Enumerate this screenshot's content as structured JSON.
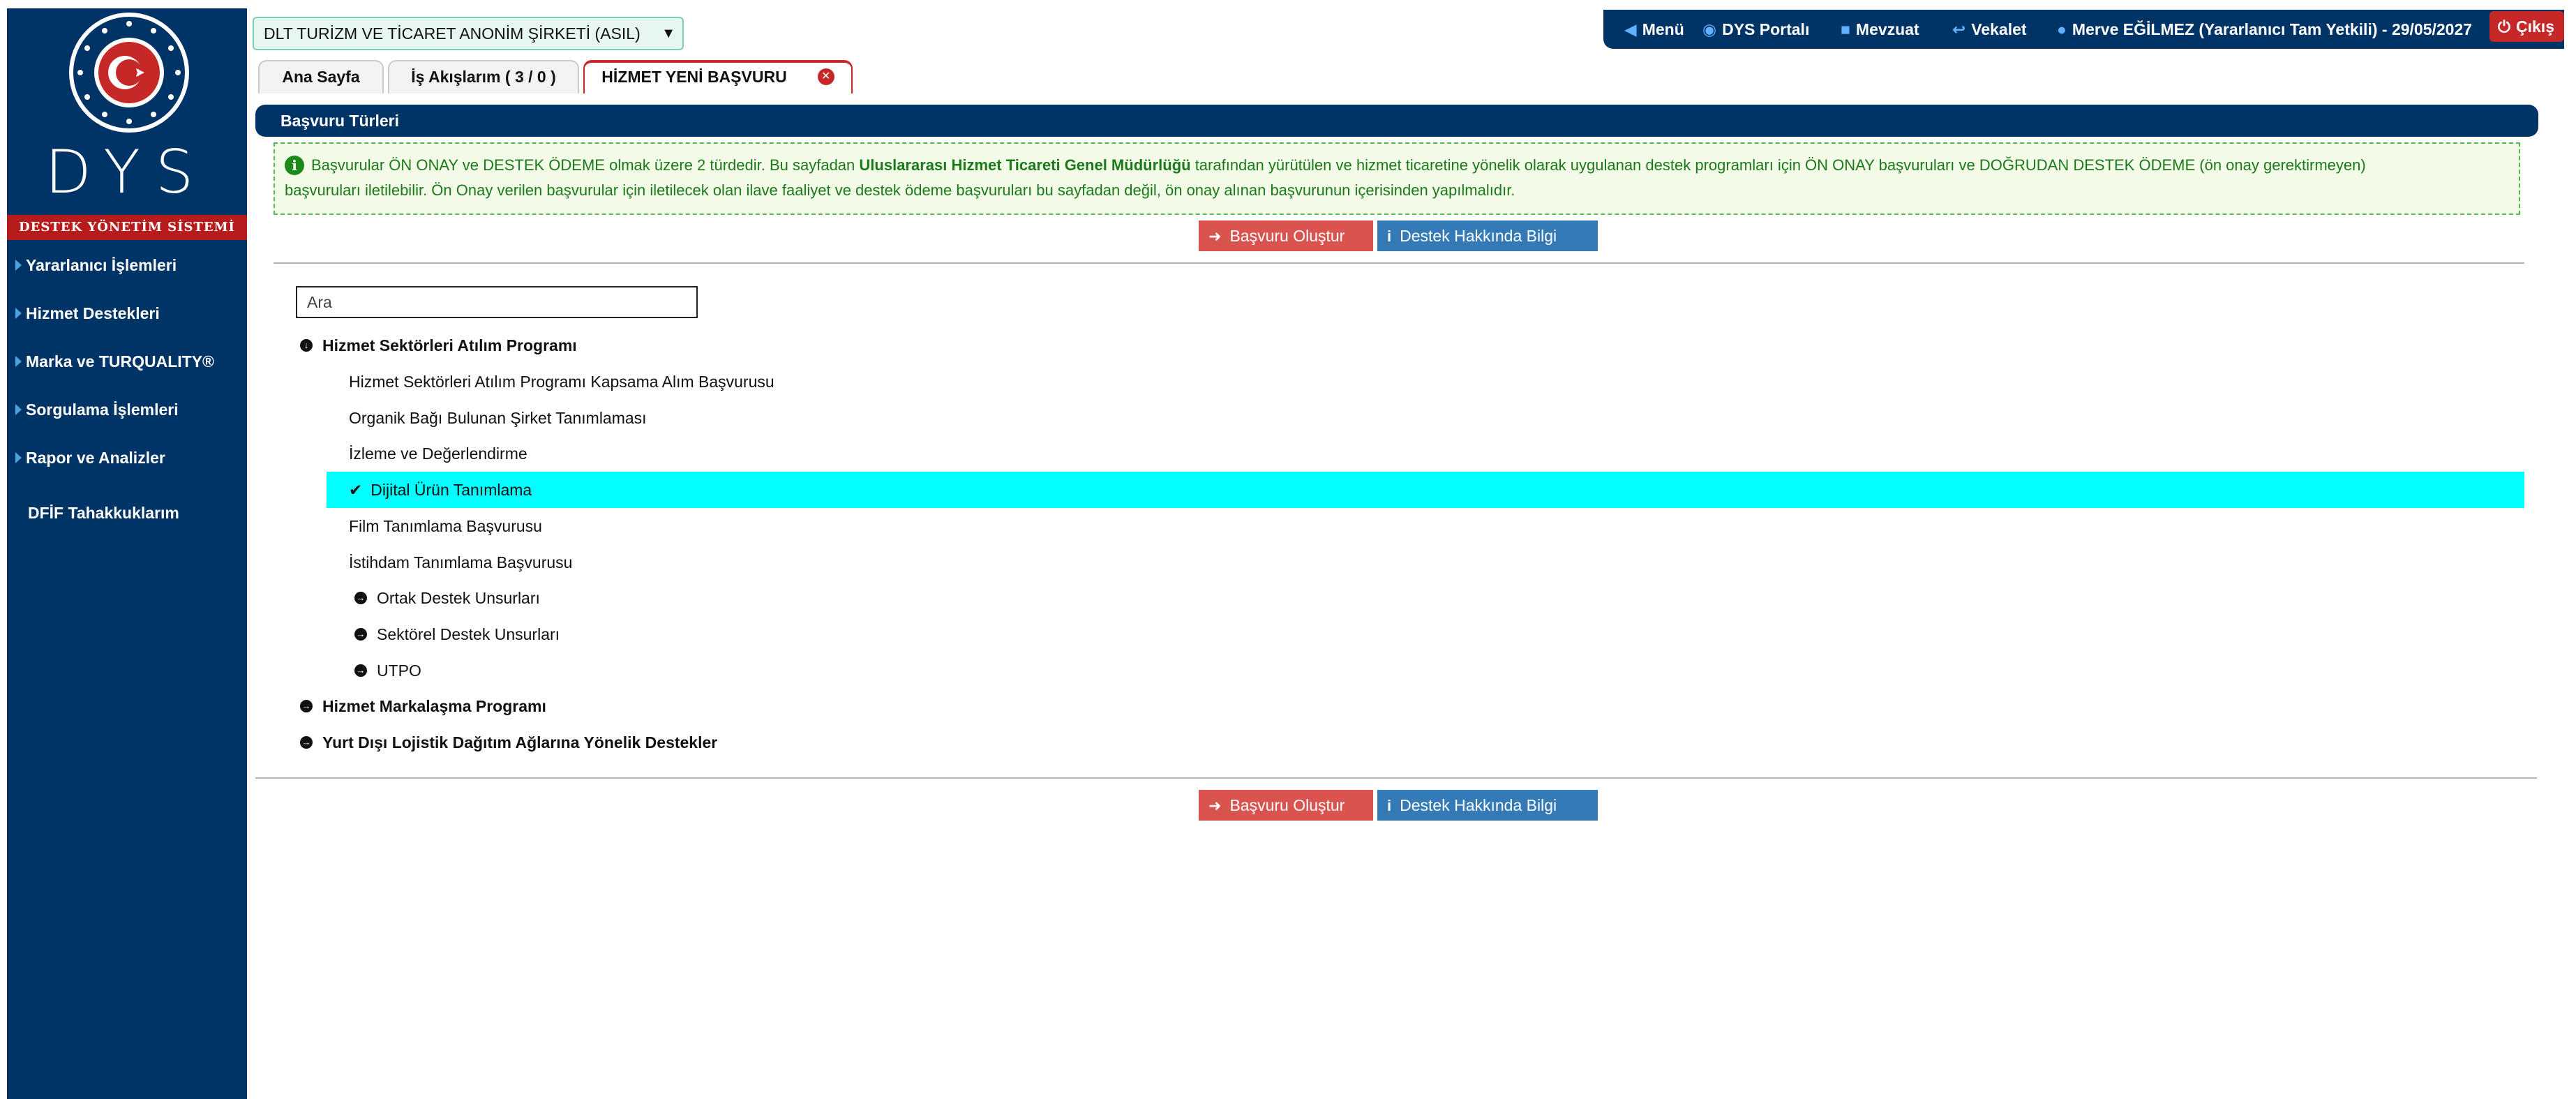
{
  "sidebar": {
    "logo_alt": "Ticaret Bakanlığı",
    "brand": "DYS",
    "brand_subtitle": "DESTEK YÖNETİM SİSTEMİ",
    "items": [
      {
        "label": "Yararlanıcı İşlemleri"
      },
      {
        "label": "Hizmet Destekleri"
      },
      {
        "label": "Marka ve TURQUALITY®"
      },
      {
        "label": "Sorgulama İşlemleri"
      },
      {
        "label": "Rapor ve Analizler"
      },
      {
        "label": "DFİF Tahakkuklarım"
      }
    ]
  },
  "header": {
    "company_select": "DLT TURİZM VE TİCARET ANONİM ŞİRKETİ (ASIL)",
    "nav": {
      "menu": "Menü",
      "portal": "DYS Portalı",
      "mevzuat": "Mevzuat",
      "vekalet": "Vekalet",
      "user": "Merve EĞİLMEZ (Yararlanıcı Tam Yetkili) - 29/05/2027",
      "logout": "Çıkış"
    }
  },
  "tabs": [
    {
      "label": "Ana Sayfa"
    },
    {
      "label": "İş Akışlarım ( 3 / 0 )"
    },
    {
      "label": "HİZMET YENİ BAŞVURU"
    }
  ],
  "panel": {
    "title": "Başvuru Türleri",
    "info_line1_a": "Başvurular ÖN ONAY ve DESTEK ÖDEME olmak üzere 2 türdedir. Bu sayfadan ",
    "info_line1_b": "Uluslararası Hizmet Ticareti Genel Müdürlüğü",
    "info_line1_c": " tarafından yürütülen ve hizmet ticaretine yönelik olarak uygulanan destek programları için ÖN ONAY başvuruları ve DOĞRUDAN DESTEK ÖDEME (ön onay gerektirmeyen)",
    "info_line2": "başvuruları iletilebilir. Ön Onay verilen başvurular için iletilecek olan ilave faaliyet ve destek ödeme başvuruları bu sayfadan değil, ön onay alınan başvurunun içerisinden yapılmalıdır.",
    "create_button": "Başvuru Oluştur",
    "info_button": "Destek Hakkında Bilgi",
    "search_placeholder": "Ara"
  },
  "tree": {
    "group1": "Hizmet Sektörleri Atılım Programı",
    "g1_items": [
      "Hizmet Sektörleri Atılım Programı Kapsama Alım Başvurusu",
      "Organik Bağı Bulunan Şirket Tanımlaması",
      "İzleme ve Değerlendirme",
      "Dijital Ürün Tanımlama",
      "Film Tanımlama Başvurusu",
      "İstihdam Tanımlama Başvurusu"
    ],
    "g1_subgroups": [
      "Ortak Destek Unsurları",
      "Sektörel Destek Unsurları",
      "UTPO"
    ],
    "group2": "Hizmet Markalaşma Programı",
    "group3": "Yurt Dışı Lojistik Dağıtım Ağlarına Yönelik Destekler"
  },
  "colors": {
    "navy": "#003366",
    "danger": "#d9534f",
    "primary": "#337ab7",
    "selected": "#00ffff",
    "info_text": "#1a7a1a"
  }
}
